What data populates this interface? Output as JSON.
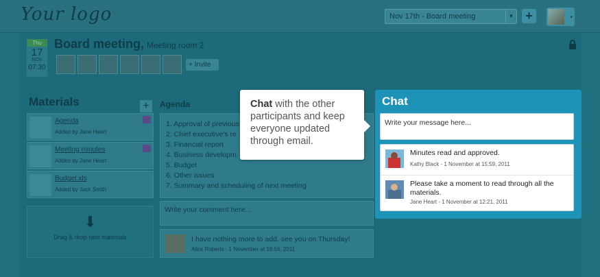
{
  "app": {
    "logo": "Your logo"
  },
  "header": {
    "meeting_select": "Nov 17th - Board meeting",
    "add_button": "+",
    "user_caret": "▾"
  },
  "meeting": {
    "date": {
      "dow": "Thu",
      "day": "17",
      "month": "NOV",
      "time": "07:30"
    },
    "title": "Board meeting,",
    "room": "Meeting room 2",
    "invite_label": "+ Invite"
  },
  "materials": {
    "title": "Materials",
    "add": "+",
    "items": [
      {
        "name": "Agenda",
        "added_by": "Added by Jane Heart"
      },
      {
        "name": "Meeting minutes",
        "added_by": "Added by Jane Heart"
      },
      {
        "name": "Budget.xls",
        "added_by": "Added by Jack Smith"
      }
    ],
    "dropzone": "Drag & drop new materials"
  },
  "agenda": {
    "title": "Agenda",
    "items": [
      "1.  Approval of previous",
      "2.  Chief executive's re",
      "3.  Financial report",
      "4.  Business developm",
      "5.  Budget",
      "6.  Other issues",
      "7.  Summary and scheduling of next meeting"
    ],
    "comment_placeholder": "Write your comment here...",
    "comment": {
      "text": "I have nothing more to add, see you on Thursday!",
      "meta": "Alice Roberts - 1 November at 16:56, 2011"
    }
  },
  "callout": {
    "bold": "Chat",
    "rest": " with the other participants and keep everyone updated through email."
  },
  "chat": {
    "title": "Chat",
    "placeholder": "Write your message here...",
    "messages": [
      {
        "text": "Minutes read and approved.",
        "meta": "Kathy Black - 1 November at 15:59, 2011"
      },
      {
        "text": "Please take a moment to read through all the materials.",
        "meta": "Jane Heart - 1 November at 12:21, 2011"
      }
    ]
  },
  "colors": {
    "chat_panel": "#1d93b7",
    "background": "#1f6f7f",
    "date_header": "#3d8a57"
  }
}
